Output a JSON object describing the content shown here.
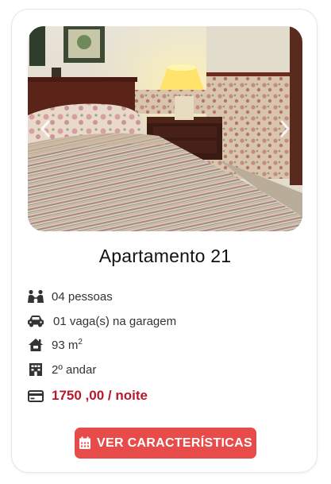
{
  "listing": {
    "title": "Apartamento 21",
    "features": [
      {
        "icon": "people-icon",
        "text": "04 pessoas"
      },
      {
        "icon": "car-icon",
        "text": "01 vaga(s) na garagem"
      },
      {
        "icon": "house-icon",
        "text": "93 m",
        "superscript": "2"
      },
      {
        "icon": "building-icon",
        "text": "2º andar"
      }
    ],
    "price": {
      "icon": "credit-card-icon",
      "text": "1750 ,00 / noite"
    },
    "button": {
      "icon": "calendar-icon",
      "label": "VER CARACTERÍSTICAS"
    }
  },
  "colors": {
    "price": "#b8192a",
    "button": "#e84c4a",
    "icon": "#333333"
  }
}
